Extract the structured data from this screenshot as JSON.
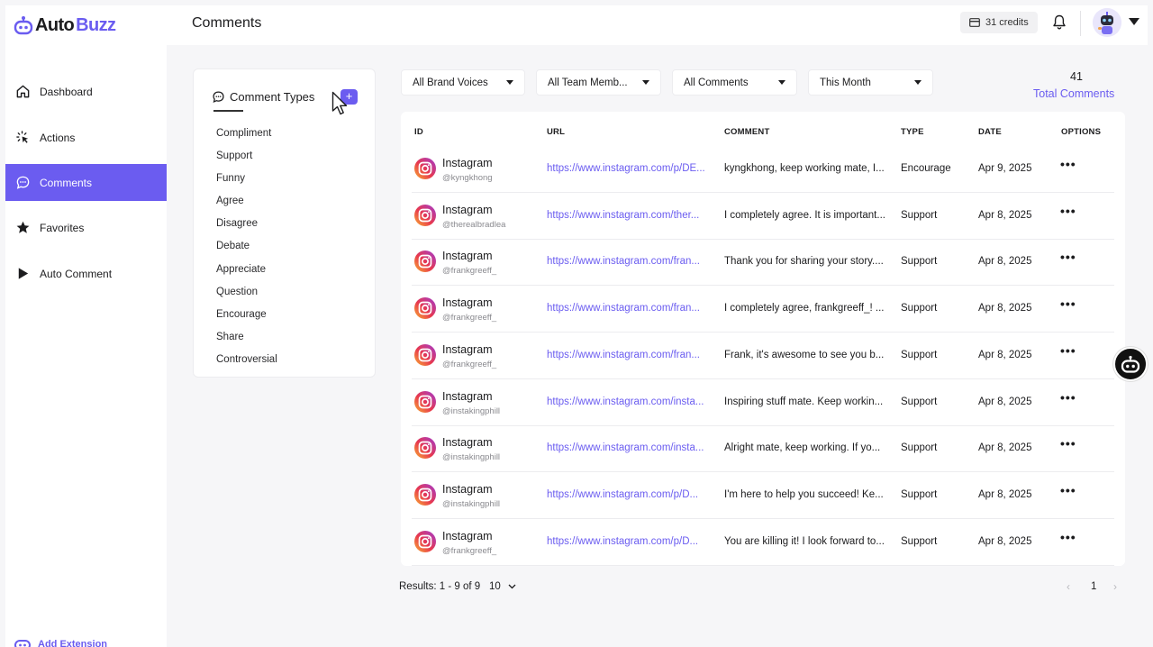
{
  "brand": {
    "part1": "Auto",
    "part2": "Buzz"
  },
  "colors": {
    "accent": "#6b5cf0",
    "link": "#6a5cf0",
    "background": "#f6f6f8"
  },
  "sidebar": {
    "items": [
      {
        "label": "Dashboard",
        "icon": "home-icon",
        "active": false
      },
      {
        "label": "Actions",
        "icon": "sparkle-click-icon",
        "active": false
      },
      {
        "label": "Comments",
        "icon": "chat-bubble-icon",
        "active": true
      },
      {
        "label": "Favorites",
        "icon": "star-icon",
        "active": false
      },
      {
        "label": "Auto Comment",
        "icon": "play-icon",
        "active": false
      }
    ],
    "footer_label": "Add Extension"
  },
  "header": {
    "title": "Comments",
    "credits": "31 credits"
  },
  "comment_types": {
    "title": "Comment Types",
    "add_label": "+",
    "items": [
      "Compliment",
      "Support",
      "Funny",
      "Agree",
      "Disagree",
      "Debate",
      "Appreciate",
      "Question",
      "Encourage",
      "Share",
      "Controversial"
    ]
  },
  "filters": [
    {
      "label": "All Brand Voices"
    },
    {
      "label": "All Team Memb..."
    },
    {
      "label": "All Comments"
    },
    {
      "label": "This Month"
    }
  ],
  "totals": {
    "count": "41",
    "label": "Total Comments"
  },
  "table": {
    "columns": [
      "ID",
      "URL",
      "COMMENT",
      "TYPE",
      "DATE",
      "OPTIONS"
    ],
    "rows": [
      {
        "platform": "Instagram",
        "handle": "@kyngkhong",
        "url": "https://www.instagram.com/p/DE...",
        "comment": "kyngkhong, keep working mate, I...",
        "type": "Encourage",
        "date": "Apr 9, 2025"
      },
      {
        "platform": "Instagram",
        "handle": "@therealbradlea",
        "url": "https://www.instagram.com/ther...",
        "comment": "I completely agree. It is important...",
        "type": "Support",
        "date": "Apr 8, 2025"
      },
      {
        "platform": "Instagram",
        "handle": "@frankgreeff_",
        "url": "https://www.instagram.com/fran...",
        "comment": "Thank you for sharing your story....",
        "type": "Support",
        "date": "Apr 8, 2025"
      },
      {
        "platform": "Instagram",
        "handle": "@frankgreeff_",
        "url": "https://www.instagram.com/fran...",
        "comment": "I completely agree, frankgreeff_! ...",
        "type": "Support",
        "date": "Apr 8, 2025"
      },
      {
        "platform": "Instagram",
        "handle": "@frankgreeff_",
        "url": "https://www.instagram.com/fran...",
        "comment": "Frank, it's awesome to see you b...",
        "type": "Support",
        "date": "Apr 8, 2025"
      },
      {
        "platform": "Instagram",
        "handle": "@instakingphill",
        "url": "https://www.instagram.com/insta...",
        "comment": "Inspiring stuff mate. Keep workin...",
        "type": "Support",
        "date": "Apr 8, 2025"
      },
      {
        "platform": "Instagram",
        "handle": "@instakingphill",
        "url": "https://www.instagram.com/insta...",
        "comment": "Alright mate, keep working. If yo...",
        "type": "Support",
        "date": "Apr 8, 2025"
      },
      {
        "platform": "Instagram",
        "handle": "@instakingphill",
        "url": "https://www.instagram.com/p/D...",
        "comment": "I'm here to help you succeed! Ke...",
        "type": "Support",
        "date": "Apr 8, 2025"
      },
      {
        "platform": "Instagram",
        "handle": "@frankgreeff_",
        "url": "https://www.instagram.com/p/D...",
        "comment": "You are killing it! I look forward to...",
        "type": "Support",
        "date": "Apr 8, 2025"
      }
    ],
    "options_glyph": "•••"
  },
  "footer": {
    "results": "Results: 1 - 9 of 9",
    "page_size": "10",
    "current_page": "1",
    "prev_glyph": "‹",
    "next_glyph": "›"
  }
}
